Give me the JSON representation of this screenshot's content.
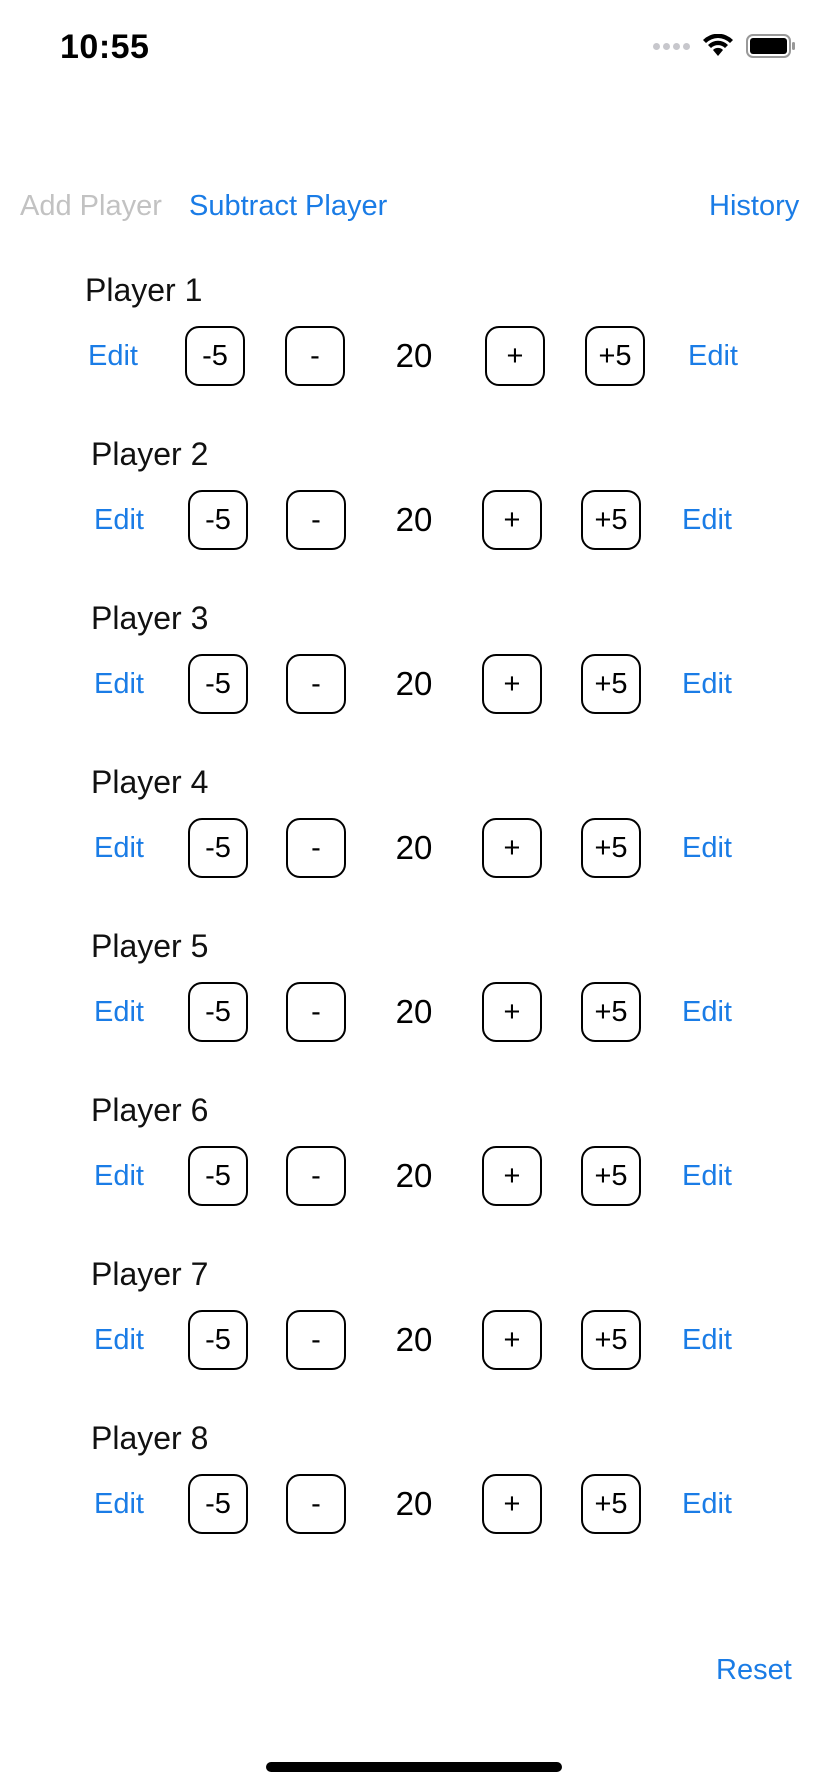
{
  "status_bar": {
    "time": "10:55",
    "icons": [
      "cellular-signal-icon",
      "wifi-icon",
      "battery-icon"
    ]
  },
  "header": {
    "add_player": "Add Player",
    "subtract_player": "Subtract Player",
    "history": "History"
  },
  "players": [
    {
      "name": "Player 1",
      "edit_left": "Edit",
      "minus_five": "-5",
      "minus": "-",
      "score": "20",
      "plus": "+",
      "plus_five": "+5",
      "edit_right": "Edit"
    },
    {
      "name": "Player 2",
      "edit_left": "Edit",
      "minus_five": "-5",
      "minus": "-",
      "score": "20",
      "plus": "+",
      "plus_five": "+5",
      "edit_right": "Edit"
    },
    {
      "name": "Player 3",
      "edit_left": "Edit",
      "minus_five": "-5",
      "minus": "-",
      "score": "20",
      "plus": "+",
      "plus_five": "+5",
      "edit_right": "Edit"
    },
    {
      "name": "Player 4",
      "edit_left": "Edit",
      "minus_five": "-5",
      "minus": "-",
      "score": "20",
      "plus": "+",
      "plus_five": "+5",
      "edit_right": "Edit"
    },
    {
      "name": "Player 5",
      "edit_left": "Edit",
      "minus_five": "-5",
      "minus": "-",
      "score": "20",
      "plus": "+",
      "plus_five": "+5",
      "edit_right": "Edit"
    },
    {
      "name": "Player 6",
      "edit_left": "Edit",
      "minus_five": "-5",
      "minus": "-",
      "score": "20",
      "plus": "+",
      "plus_five": "+5",
      "edit_right": "Edit"
    },
    {
      "name": "Player 7",
      "edit_left": "Edit",
      "minus_five": "-5",
      "minus": "-",
      "score": "20",
      "plus": "+",
      "plus_five": "+5",
      "edit_right": "Edit"
    },
    {
      "name": "Player 8",
      "edit_left": "Edit",
      "minus_five": "-5",
      "minus": "-",
      "score": "20",
      "plus": "+",
      "plus_five": "+5",
      "edit_right": "Edit"
    }
  ],
  "footer": {
    "reset": "Reset"
  },
  "colors": {
    "accent": "#1a7ce6",
    "disabled": "#c2c2c2",
    "text": "#000000"
  }
}
